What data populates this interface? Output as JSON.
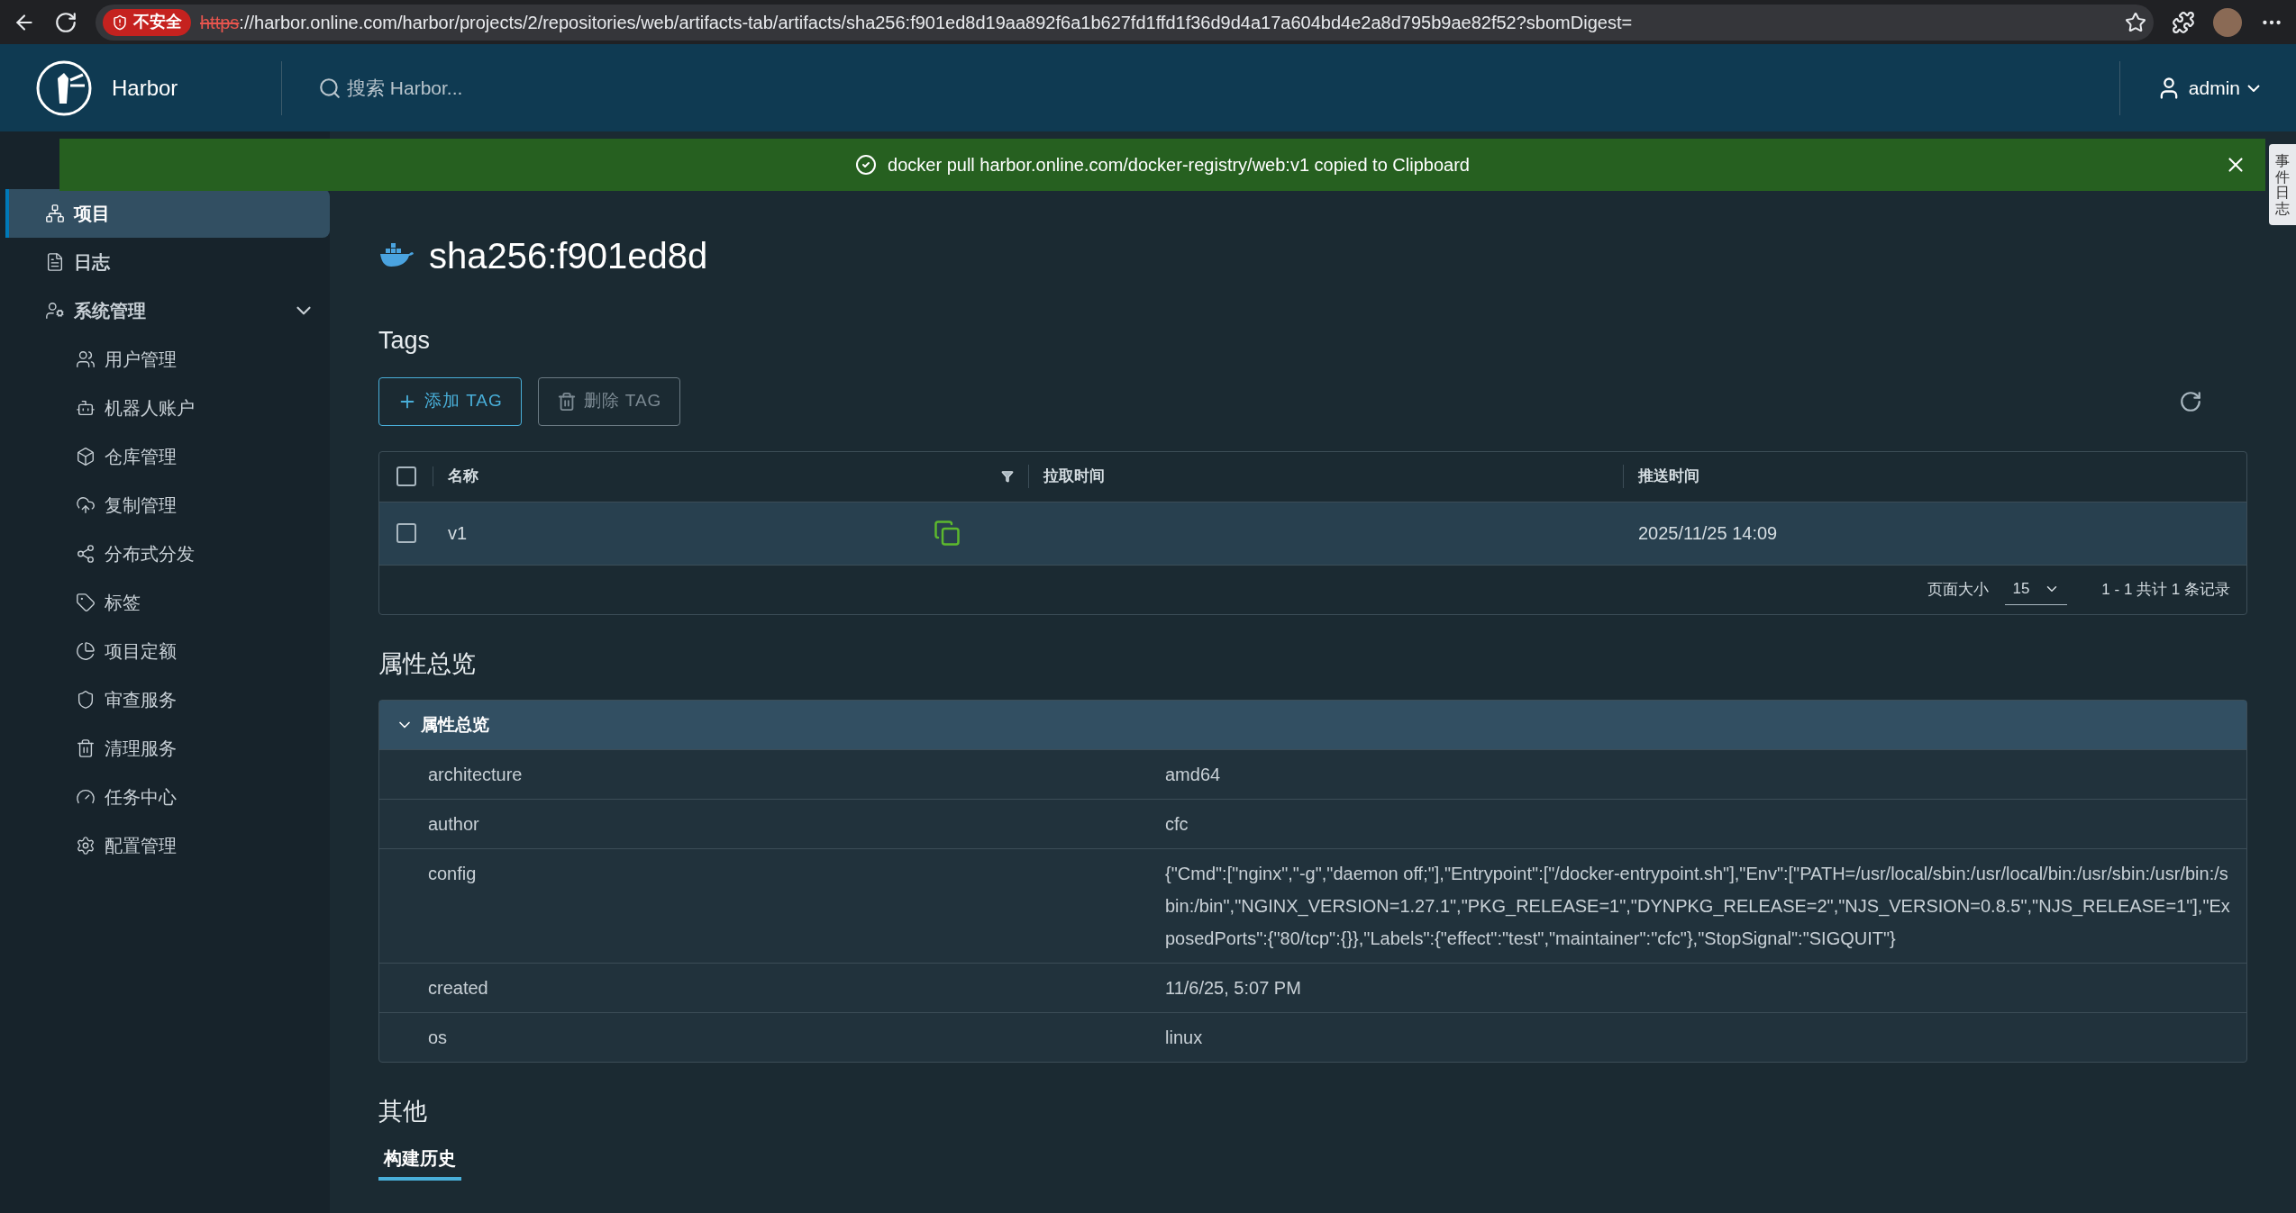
{
  "browser": {
    "security_label": "不安全",
    "url_scheme": "https",
    "url_rest": "://harbor.online.com/harbor/projects/2/repositories/web/artifacts-tab/artifacts/sha256:f901ed8d19aa892f6a1b627fd1ffd1f36d9d4a17a604bd4e2a8d795b9ae82f52?sbomDigest="
  },
  "header": {
    "app_name": "Harbor",
    "search_placeholder": "搜索 Harbor...",
    "user": "admin"
  },
  "banner": {
    "message": "docker pull harbor.online.com/docker-registry/web:v1 copied to Clipboard"
  },
  "sidebar": {
    "items": [
      {
        "label": "项目",
        "selected": true
      },
      {
        "label": "日志",
        "selected": false
      },
      {
        "label": "系统管理",
        "selected": false,
        "expanded": true,
        "children": [
          {
            "label": "用户管理",
            "selected": false
          },
          {
            "label": "机器人账户",
            "selected": false
          },
          {
            "label": "仓库管理",
            "selected": false
          },
          {
            "label": "复制管理",
            "selected": false
          },
          {
            "label": "分布式分发",
            "selected": false
          },
          {
            "label": "标签",
            "selected": false
          },
          {
            "label": "项目定额",
            "selected": false
          },
          {
            "label": "审查服务",
            "selected": false
          },
          {
            "label": "清理服务",
            "selected": false
          },
          {
            "label": "任务中心",
            "selected": false
          },
          {
            "label": "配置管理",
            "selected": false
          }
        ]
      }
    ]
  },
  "artifact": {
    "title": "sha256:f901ed8d"
  },
  "tags": {
    "title": "Tags",
    "buttons": [
      {
        "label": "添加 TAG",
        "disabled": false
      },
      {
        "label": "删除 TAG",
        "disabled": true
      }
    ],
    "select_all_checked": false,
    "columns": [
      "名称",
      "拉取时间",
      "推送时间"
    ],
    "rows": [
      {
        "checked": false,
        "name": "v1",
        "pull_time": "",
        "push_time": "2025/11/25 14:09"
      }
    ],
    "page_size_label": "页面大小",
    "page_size": "15",
    "summary": "1 - 1 共计 1 条记录"
  },
  "properties": {
    "heading": "属性总览",
    "panel_title": "属性总览",
    "expanded": true,
    "rows": [
      {
        "key": "architecture",
        "value": "amd64"
      },
      {
        "key": "author",
        "value": "cfc"
      },
      {
        "key": "config",
        "value": "{\"Cmd\":[\"nginx\",\"-g\",\"daemon off;\"],\"Entrypoint\":[\"/docker-entrypoint.sh\"],\"Env\":[\"PATH=/usr/local/sbin:/usr/local/bin:/usr/sbin:/usr/bin:/sbin:/bin\",\"NGINX_VERSION=1.27.1\",\"PKG_RELEASE=1\",\"DYNPKG_RELEASE=2\",\"NJS_VERSION=0.8.5\",\"NJS_RELEASE=1\"],\"ExposedPorts\":{\"80/tcp\":{}},\"Labels\":{\"effect\":\"test\",\"maintainer\":\"cfc\"},\"StopSignal\":\"SIGQUIT\"}"
      },
      {
        "key": "created",
        "value": "11/6/25, 5:07 PM"
      },
      {
        "key": "os",
        "value": "linux"
      }
    ]
  },
  "other": {
    "heading": "其他",
    "tabs": [
      {
        "label": "构建历史",
        "selected": true
      }
    ]
  },
  "side_tab": {
    "label": "事件日志"
  }
}
